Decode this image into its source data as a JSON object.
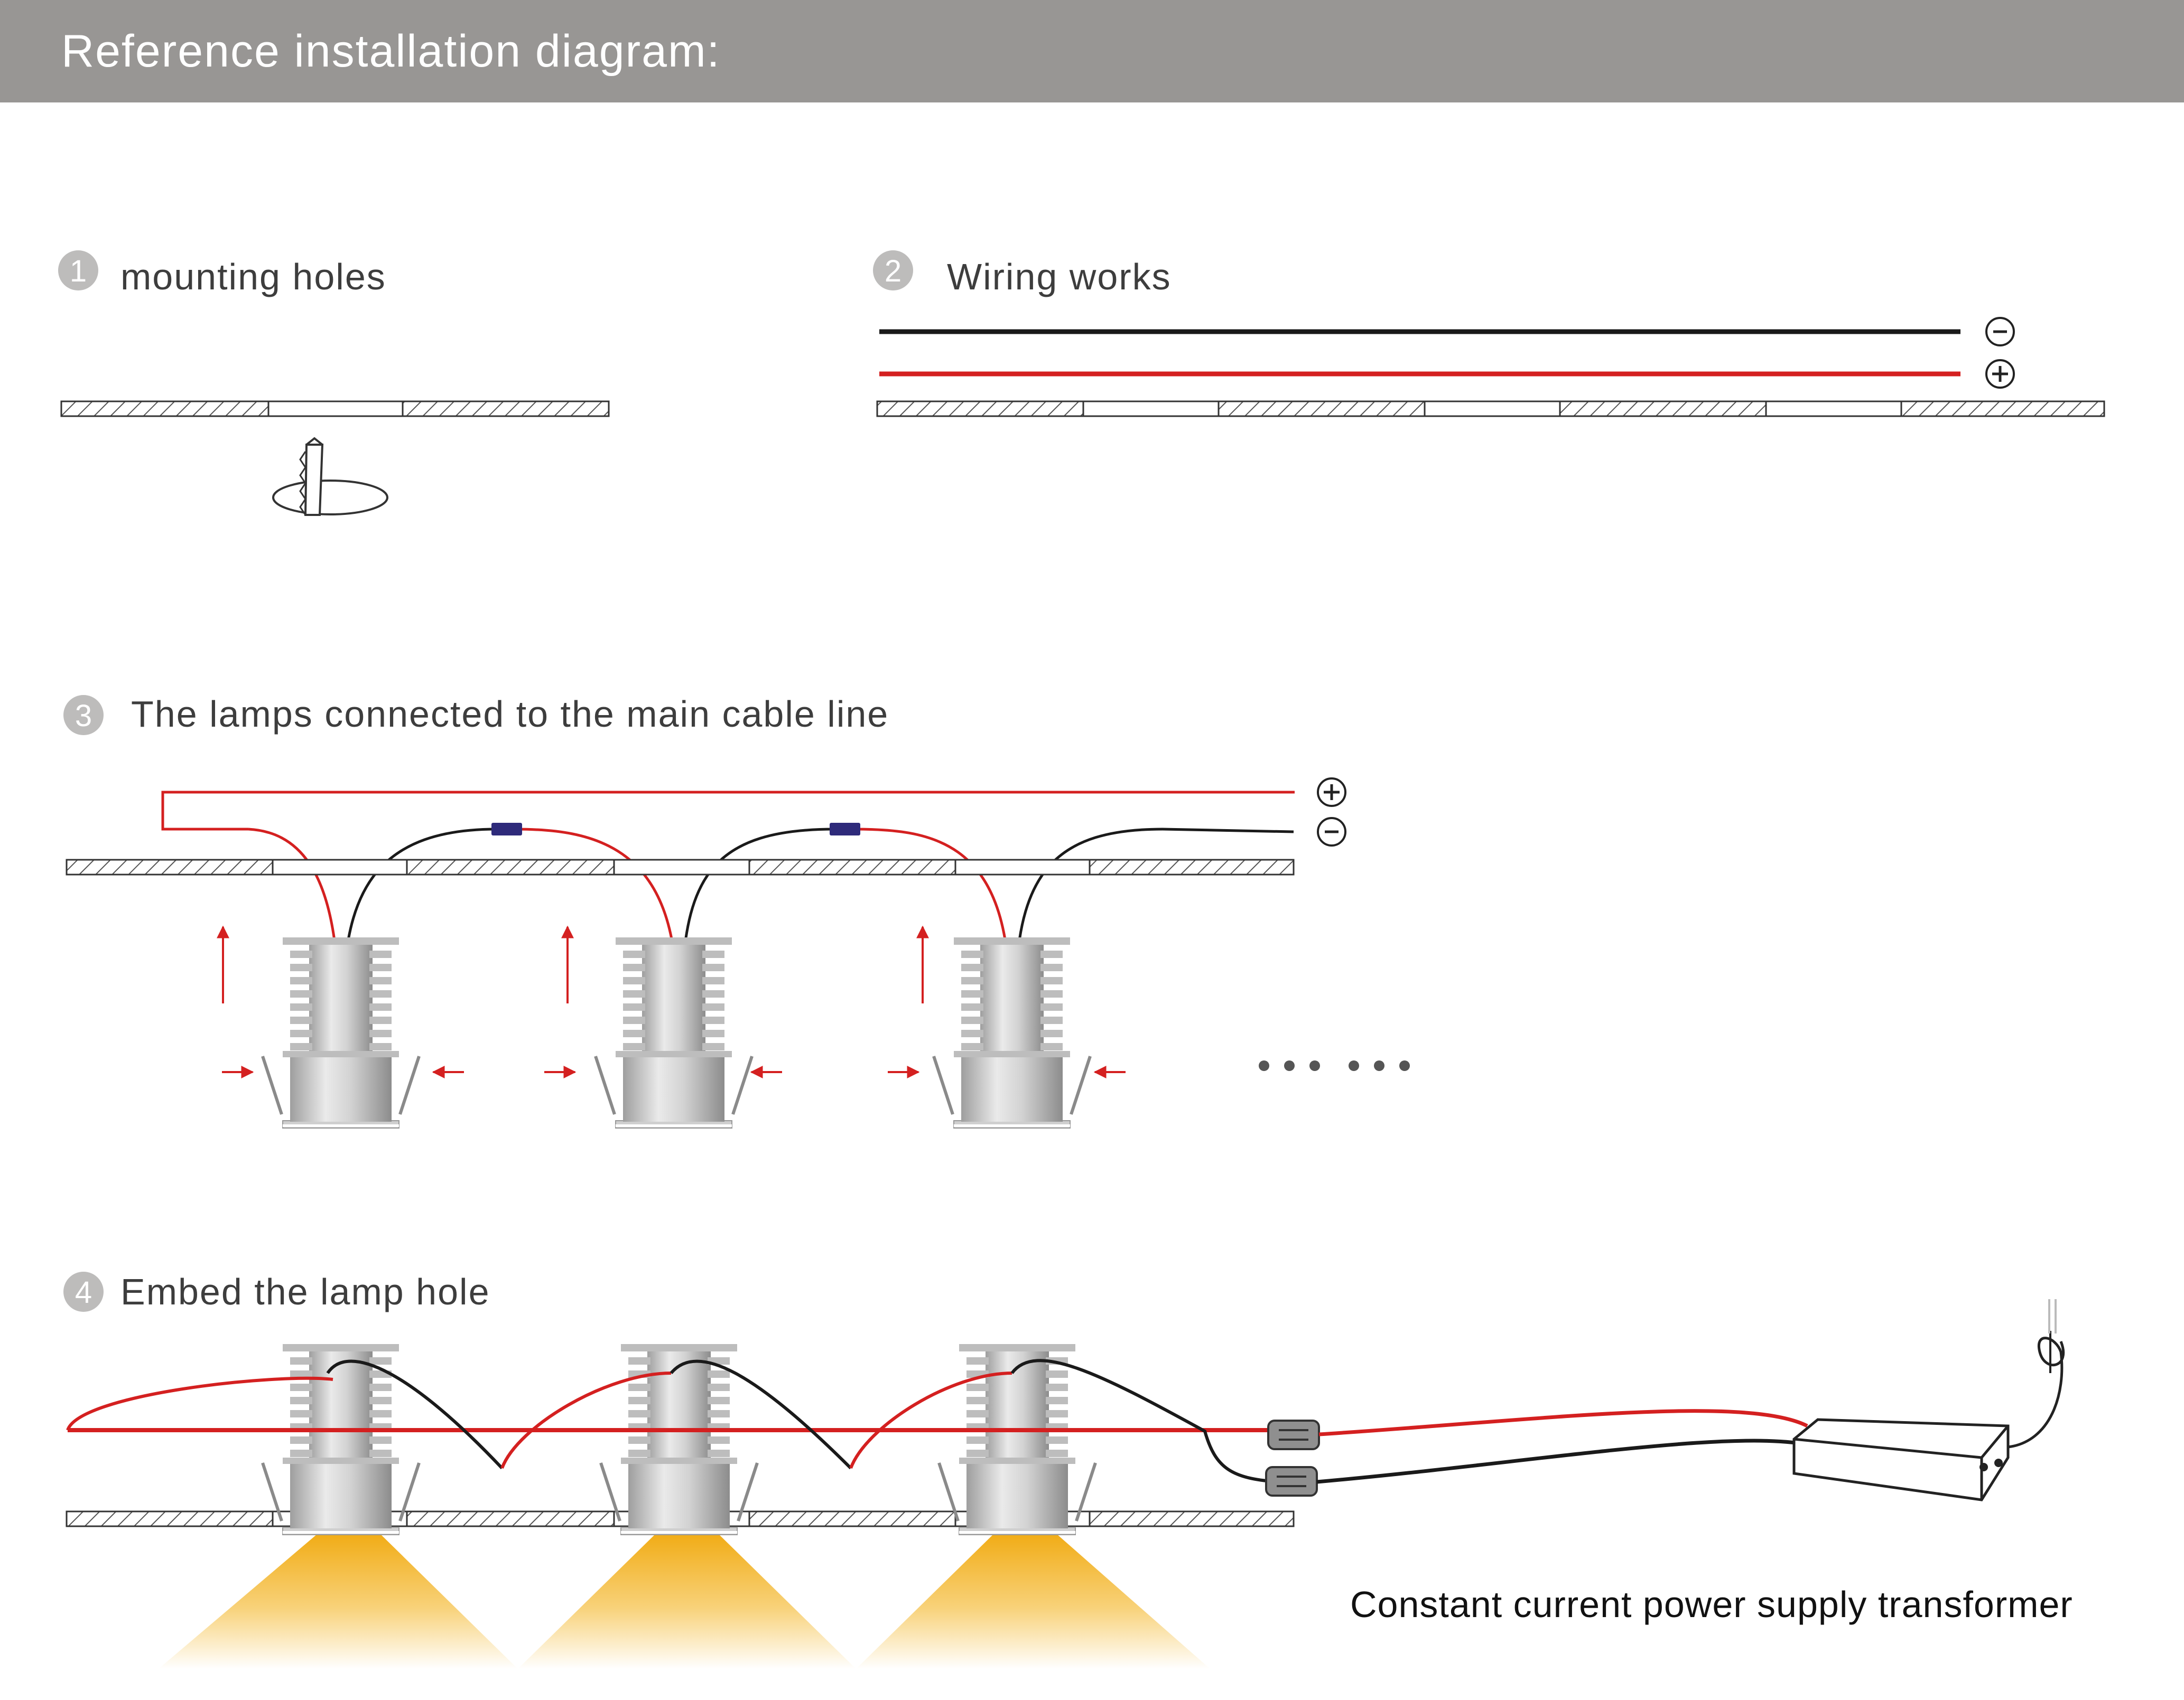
{
  "header": {
    "title": "Reference installation diagram:"
  },
  "steps": [
    {
      "number": "1",
      "title": "mounting holes"
    },
    {
      "number": "2",
      "title": "Wiring works"
    },
    {
      "number": "3",
      "title": "The lamps connected to the main cable line"
    },
    {
      "number": "4",
      "title": "Embed the lamp hole"
    }
  ],
  "polarity": {
    "negative": "-",
    "positive": "+"
  },
  "caption": "Constant current power supply transformer",
  "colors": {
    "header": "#989694",
    "wire_positive": "#d42020",
    "wire_negative": "#1a1a1a",
    "connector": "#2e2a7a",
    "light": "#f2b21e"
  }
}
